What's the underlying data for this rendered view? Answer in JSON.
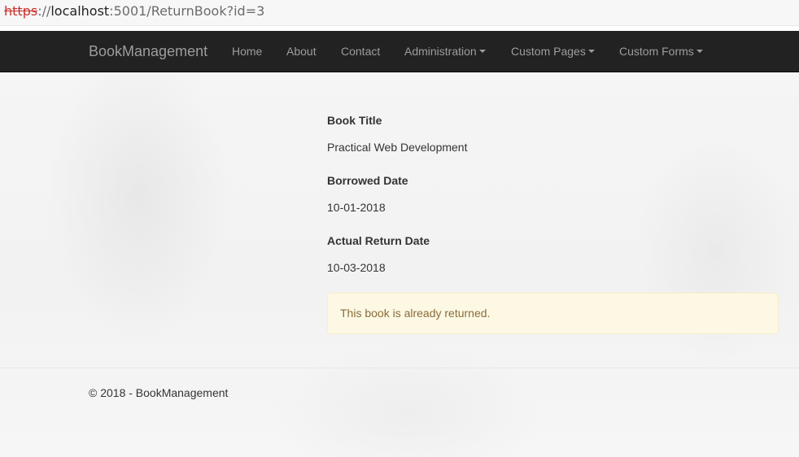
{
  "browser": {
    "url_scheme": "https",
    "url_separator": "://",
    "url_host": "localhost",
    "url_rest": ":5001/ReturnBook?id=3"
  },
  "navbar": {
    "brand": "BookManagement",
    "items": [
      {
        "label": "Home",
        "dropdown": false
      },
      {
        "label": "About",
        "dropdown": false
      },
      {
        "label": "Contact",
        "dropdown": false
      },
      {
        "label": "Administration",
        "dropdown": true
      },
      {
        "label": "Custom Pages",
        "dropdown": true
      },
      {
        "label": "Custom Forms",
        "dropdown": true
      }
    ],
    "background": "#222222",
    "text_color": "#9d9d9d"
  },
  "details": {
    "book_title_label": "Book Title",
    "book_title_value": "Practical Web Development",
    "borrowed_date_label": "Borrowed Date",
    "borrowed_date_value": "10-01-2018",
    "return_date_label": "Actual Return Date",
    "return_date_value": "10-03-2018"
  },
  "alert": {
    "message": "This book is already returned.",
    "background": "#fcf8e3",
    "text_color": "#8a6d3b"
  },
  "footer": {
    "text": "© 2018 - BookManagement"
  }
}
